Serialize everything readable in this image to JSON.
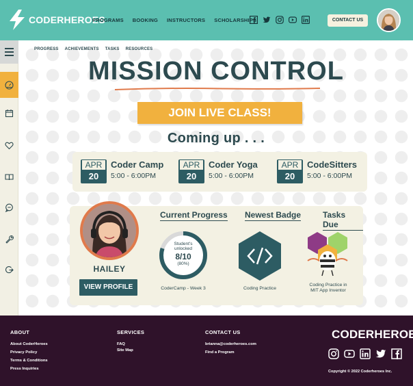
{
  "brand": {
    "name": "CODERHEROES"
  },
  "nav": {
    "items": [
      "PROGRAMS",
      "BOOKING",
      "INSTRUCTORS",
      "SCHOLARSHIPS"
    ]
  },
  "header": {
    "contact_label": "CONTACT US",
    "social_icons": [
      "facebook-icon",
      "twitter-icon",
      "instagram-icon",
      "youtube-icon",
      "linkedin-icon"
    ]
  },
  "subnav": {
    "items": [
      "PROGRESS",
      "ACHIEVEMENTS",
      "TASKS",
      "RESOURCES"
    ]
  },
  "sidebar": {
    "icons": [
      "menu-icon",
      "dashboard-icon",
      "calendar-icon",
      "heart-icon",
      "book-icon",
      "chat-icon",
      "wrench-icon",
      "logout-icon"
    ],
    "active": "dashboard-icon"
  },
  "main": {
    "title": "MISSION CONTROL",
    "join_label": "JOIN LIVE CLASS!",
    "coming_up": "Coming up . . ."
  },
  "events": [
    {
      "month": "APR",
      "day": "20",
      "title": "Coder Camp",
      "time": "5:00 - 6:00PM"
    },
    {
      "month": "APR",
      "day": "20",
      "title": "Coder Yoga",
      "time": "5:00 - 6:00PM"
    },
    {
      "month": "APR",
      "day": "20",
      "title": "CodeSitters",
      "time": "5:00 - 6:00PM"
    }
  ],
  "profile": {
    "name": "HAILEY",
    "view_label": "VIEW PROFILE"
  },
  "progress": {
    "title": "Current Progress",
    "line1": "Student's",
    "line2": "unlocked",
    "value": "8/10",
    "percent": "(80%)",
    "fraction": 0.8,
    "caption": "CoderCamp - Week 3"
  },
  "badge": {
    "title": "Newest Badge",
    "caption": "Coding Practice",
    "icon": "code-brackets-icon"
  },
  "tasks": {
    "title": "Tasks Due",
    "caption_line1": "Coding Practice in",
    "caption_line2": "MIT App Inventor",
    "icon": "bee-mascot-icon"
  },
  "footer": {
    "about": {
      "title": "ABOUT",
      "links": [
        "About CoderHeroes",
        "Privacy Policy",
        "Terms & Conditions",
        "Press Inquiries"
      ]
    },
    "services": {
      "title": "SERVICES",
      "links": [
        "FAQ",
        "Site Map"
      ]
    },
    "contact": {
      "title": "CONTACT US",
      "links": [
        "brianna@coderheroes.com",
        "Find a Program"
      ]
    },
    "brand": "CODERHEROES",
    "social_icons": [
      "instagram-icon",
      "youtube-icon",
      "linkedin-icon",
      "twitter-icon",
      "facebook-icon"
    ],
    "copyright": "Copyright © 2022 Coderheroes Inc."
  },
  "colors": {
    "teal": "#5bbfb0",
    "dark_teal": "#2d5c63",
    "orange": "#f1b13e",
    "cream": "#f3f1e3",
    "footer": "#2f122a"
  }
}
